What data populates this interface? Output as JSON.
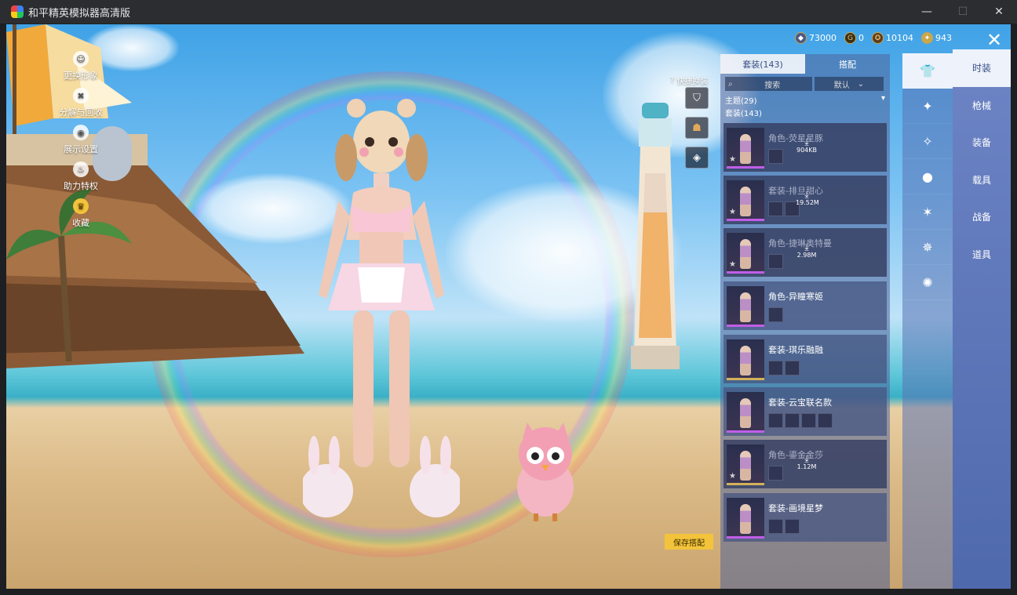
{
  "window": {
    "title": "和平精英模拟器高清版",
    "minimize": "—",
    "maximize": "☐",
    "close": "✕"
  },
  "left_menu": [
    {
      "label": "更换形象",
      "icon": "person-icon"
    },
    {
      "label": "分解与回收",
      "icon": "recycle-icon"
    },
    {
      "label": "展示设置",
      "icon": "eye-icon"
    },
    {
      "label": "助力特权",
      "icon": "flame-icon"
    },
    {
      "label": "收藏",
      "icon": "crown-icon"
    }
  ],
  "currency": [
    {
      "value": "73000",
      "icon": "diamond-coin-icon",
      "color": "#6d7fae"
    },
    {
      "value": "0",
      "icon": "gold-coin-icon",
      "color": "#c9a34e"
    },
    {
      "value": "10104",
      "icon": "medal-coin-icon",
      "color": "#b0884a"
    },
    {
      "value": "943",
      "icon": "star-coin-icon",
      "color": "#d6b85c"
    }
  ],
  "quick_change": {
    "label": "快捷换装"
  },
  "save_button": "保存搭配",
  "panel": {
    "tabs": [
      {
        "label": "套装(143)",
        "active": true
      },
      {
        "label": "搭配",
        "active": false
      }
    ],
    "search_label": "搜索",
    "sort_label": "默认",
    "theme_row": "主题(29)",
    "suit_row": "套装(143)",
    "items": [
      {
        "name": "角色-荧星星豚",
        "rank": "purple",
        "downloadable": true,
        "size": "904KB",
        "minis": 1,
        "dim": true
      },
      {
        "name": "套装-排旦甜心",
        "rank": "purple",
        "downloadable": true,
        "size": "19.52M",
        "minis": 2,
        "dim": true
      },
      {
        "name": "角色-捷琳奥特曼",
        "rank": "purple",
        "downloadable": true,
        "size": "2.98M",
        "minis": 1,
        "dim": true
      },
      {
        "name": "角色-异瞳寒姬",
        "rank": "purple",
        "downloadable": false,
        "size": "",
        "minis": 1,
        "dim": false
      },
      {
        "name": "套装-琪乐融融",
        "rank": "gold",
        "downloadable": false,
        "size": "",
        "minis": 2,
        "dim": false
      },
      {
        "name": "套装-云宝联名款",
        "rank": "purple",
        "downloadable": false,
        "size": "",
        "minis": 4,
        "dim": false
      },
      {
        "name": "角色-鎏金金莎",
        "rank": "gold",
        "downloadable": true,
        "size": "1.12M",
        "minis": 1,
        "dim": true
      },
      {
        "name": "套装-画境星梦",
        "rank": "purple",
        "downloadable": false,
        "size": "",
        "minis": 2,
        "dim": false
      }
    ]
  },
  "category_icons": [
    {
      "icon": "outfit-icon",
      "active": true
    },
    {
      "icon": "weapon-skin-icon",
      "active": false
    },
    {
      "icon": "parachute-icon",
      "active": false
    },
    {
      "icon": "pet-icon",
      "active": false
    },
    {
      "icon": "emote-icon",
      "active": false
    },
    {
      "icon": "action-icon",
      "active": false
    },
    {
      "icon": "companion-icon",
      "active": false
    }
  ],
  "right_tabs": [
    {
      "label": "时装",
      "active": true
    },
    {
      "label": "枪械",
      "active": false
    },
    {
      "label": "装备",
      "active": false
    },
    {
      "label": "载具",
      "active": false
    },
    {
      "label": "战备",
      "active": false
    },
    {
      "label": "道具",
      "active": false
    }
  ]
}
